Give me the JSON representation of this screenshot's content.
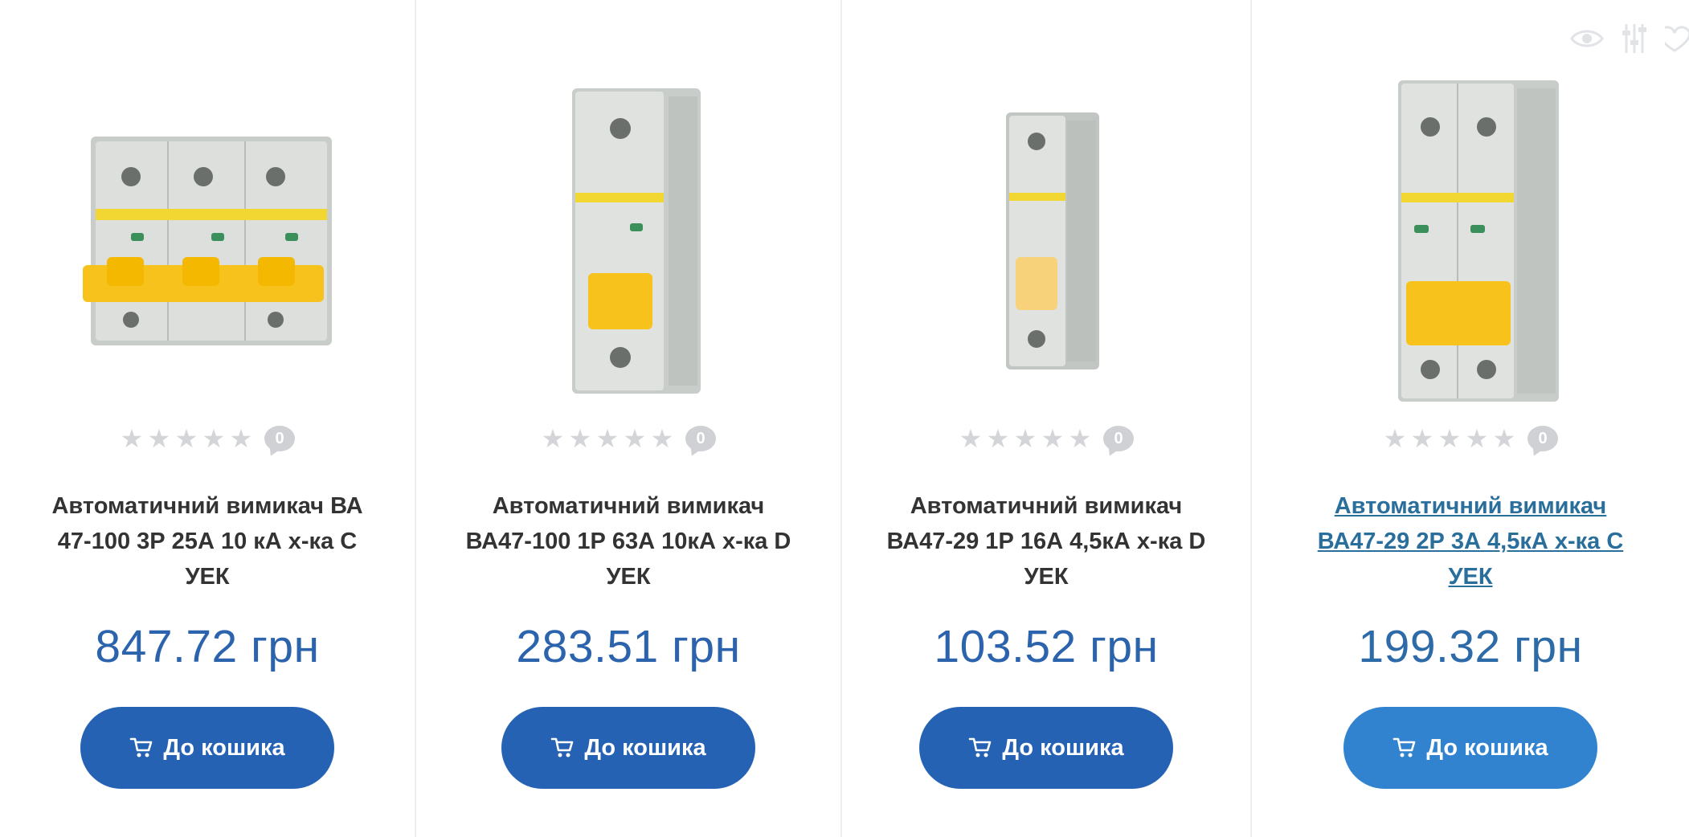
{
  "products": [
    {
      "title": "Автоматичний вимикач ВА 47-100 3Р 25А 10 кА х-ка С УЕК",
      "price": "847.72 грн",
      "rating_count": "0",
      "stars": 0,
      "button_label": "До кошика",
      "image": "breaker-3-pole"
    },
    {
      "title": "Автоматичний вимикач ВА47-100 1Р 63А 10кА х-ка D УЕК",
      "price": "283.51 грн",
      "rating_count": "0",
      "stars": 0,
      "button_label": "До кошика",
      "image": "breaker-1-pole"
    },
    {
      "title": "Автоматичний вимикач ВА47-29 1Р 16А 4,5кА х-ка D УЕК",
      "price": "103.52 грн",
      "rating_count": "0",
      "stars": 0,
      "button_label": "До кошика",
      "image": "breaker-1-pole-small"
    },
    {
      "title": "Автоматичний вимикач ВА47-29 2Р 3А 4,5кА х-ка С УЕК",
      "price": "199.32 грн",
      "rating_count": "0",
      "stars": 0,
      "button_label": "До кошика",
      "image": "breaker-2-pole"
    }
  ],
  "card_action_icons": [
    "eye-icon",
    "compare-icon",
    "heart-icon"
  ],
  "colors": {
    "price": "#2b63ad",
    "button": "#2562b4",
    "button_hover": "#3183cf",
    "link_hover": "#2a6f9c",
    "star_empty": "#d3d5d8"
  }
}
